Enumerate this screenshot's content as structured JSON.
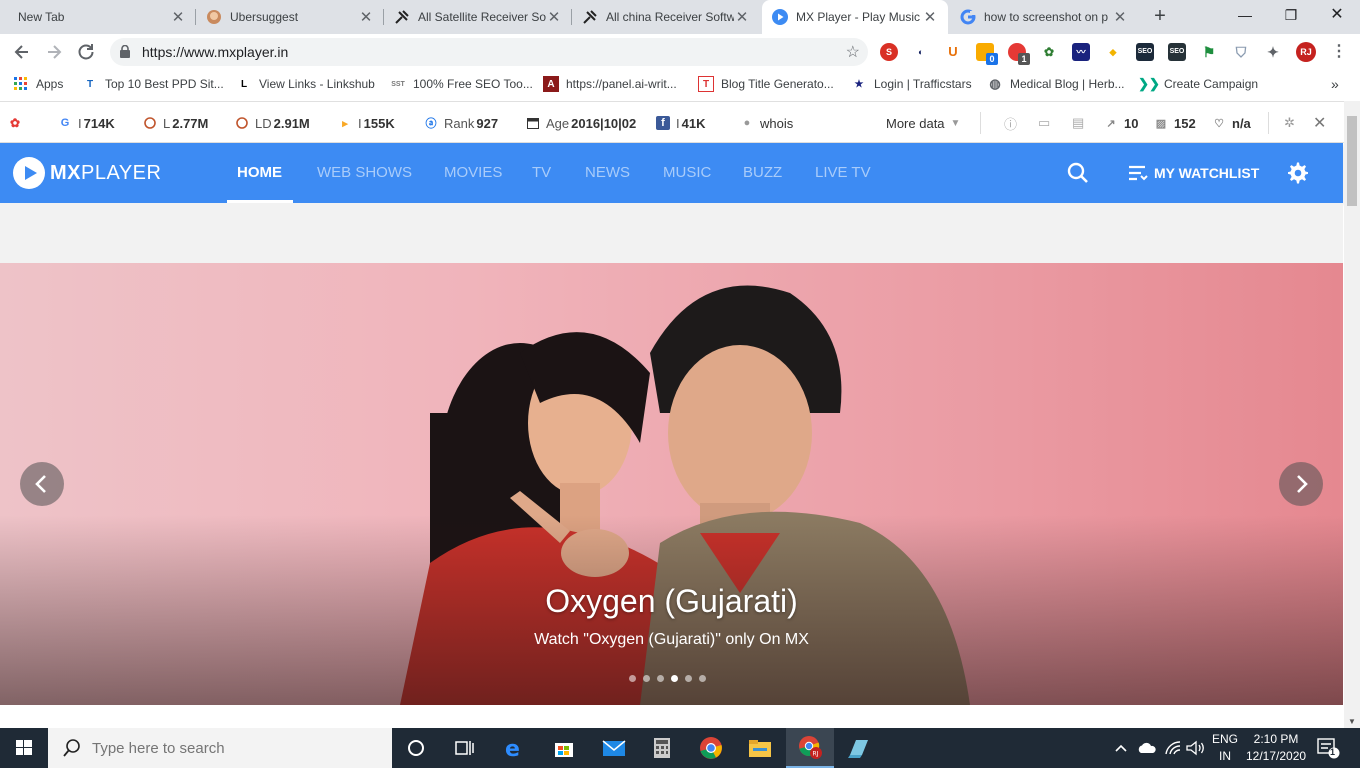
{
  "browser": {
    "tabs": [
      {
        "title": "New Tab",
        "icon": "none"
      },
      {
        "title": "Ubersuggest",
        "icon": "ubersuggest-avatar-icon"
      },
      {
        "title": "All Satellite Receiver So",
        "icon": "satellite-icon"
      },
      {
        "title": "All china Receiver Softw",
        "icon": "satellite-icon"
      },
      {
        "title": "MX Player - Play Music",
        "icon": "mx-player-icon"
      },
      {
        "title": "how to screenshot on p",
        "icon": "google-icon"
      }
    ],
    "url": "https://www.mxplayer.in",
    "profile_initials": "RJ",
    "extension_badges": {
      "badge1": "0",
      "badge2": "1"
    }
  },
  "bookmarks": [
    {
      "label": "Apps",
      "icon": "apps-grid-icon"
    },
    {
      "label": "Top 10 Best PPD Sit...",
      "icon": "tc-icon"
    },
    {
      "label": "View Links - Linkshub",
      "icon": "l-icon"
    },
    {
      "label": "100% Free SEO Too...",
      "icon": "sst-icon"
    },
    {
      "label": "https://panel.ai-writ...",
      "icon": "a-icon"
    },
    {
      "label": "Blog Title Generato...",
      "icon": "t-icon"
    },
    {
      "label": "Login | Trafficstars",
      "icon": "stars-icon"
    },
    {
      "label": "Medical Blog | Herb...",
      "icon": "globe-icon"
    },
    {
      "label": "Create Campaign",
      "icon": "chevrons-icon"
    }
  ],
  "seoquake": {
    "items": [
      {
        "prefix": "I",
        "value": "714K",
        "icon": "google-g-icon"
      },
      {
        "prefix": "L",
        "value": "2.77M",
        "icon": "circle-icon"
      },
      {
        "prefix": "LD",
        "value": "2.91M",
        "icon": "circle-icon"
      },
      {
        "prefix": "I",
        "value": "155K",
        "icon": "bing-icon"
      },
      {
        "prefix": "Rank",
        "value": "927",
        "icon": "alexa-icon"
      },
      {
        "prefix": "Age",
        "value": "2016|10|02",
        "icon": "calendar-icon"
      },
      {
        "prefix": "I",
        "value": "41K",
        "icon": "facebook-icon"
      },
      {
        "prefix": "",
        "value": "whois",
        "icon": "person-icon"
      }
    ],
    "more_data": "More data",
    "links_count": "10",
    "pages_count": "152",
    "status": "n/a"
  },
  "mx": {
    "logo_bold": "MX",
    "logo_rest": "PLAYER",
    "nav": [
      "HOME",
      "WEB SHOWS",
      "MOVIES",
      "TV",
      "NEWS",
      "MUSIC",
      "BUZZ",
      "LIVE TV"
    ],
    "watchlist": "MY WATCHLIST",
    "hero": {
      "title": "Oxygen (Gujarati)",
      "subtitle": "Watch \"Oxygen (Gujarati)\" only On MX",
      "slide_count": 6,
      "active_slide": 4
    }
  },
  "taskbar": {
    "search_placeholder": "Type here to search",
    "lang_top": "ENG",
    "lang_bottom": "IN",
    "time": "2:10 PM",
    "date": "12/17/2020",
    "notification_count": "1"
  },
  "colors": {
    "mx_blue": "#3d8bf3",
    "tab_strip": "#dee1e6",
    "taskbar": "#1f2a36"
  }
}
